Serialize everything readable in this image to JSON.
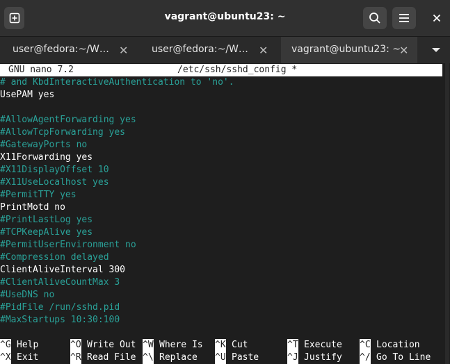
{
  "window": {
    "title": "vagrant@ubuntu23: ~",
    "new_tab_icon": "new-tab-icon",
    "search_icon": "search-icon",
    "menu_icon": "hamburger-menu-icon",
    "close_glyph": "✕"
  },
  "tabs": [
    {
      "label": "user@fedora:~/W…",
      "close": "✕",
      "active": false
    },
    {
      "label": "user@fedora:~/W…",
      "close": "✕",
      "active": false
    },
    {
      "label": "vagrant@ubuntu23: ~",
      "close": "✕",
      "active": true
    }
  ],
  "nano": {
    "version": "GNU nano 7.2",
    "filename": "/etc/ssh/sshd_config *",
    "lines": [
      {
        "text": "# and KbdInteractiveAuthentication to 'no'.",
        "comment": true
      },
      {
        "text": "UsePAM yes",
        "comment": false
      },
      {
        "text": "",
        "comment": false
      },
      {
        "text": "#AllowAgentForwarding yes",
        "comment": true
      },
      {
        "text": "#AllowTcpForwarding yes",
        "comment": true
      },
      {
        "text": "#GatewayPorts no",
        "comment": true
      },
      {
        "text": "X11Forwarding yes",
        "comment": false
      },
      {
        "text": "#X11DisplayOffset 10",
        "comment": true
      },
      {
        "text": "#X11UseLocalhost yes",
        "comment": true
      },
      {
        "text": "#PermitTTY yes",
        "comment": true
      },
      {
        "text": "PrintMotd no",
        "comment": false
      },
      {
        "text": "#PrintLastLog yes",
        "comment": true
      },
      {
        "text": "#TCPKeepAlive yes",
        "comment": true
      },
      {
        "text": "#PermitUserEnvironment no",
        "comment": true
      },
      {
        "text": "#Compression delayed",
        "comment": true
      },
      {
        "text": "ClientAliveInterval 300",
        "comment": false
      },
      {
        "text": "#ClientAliveCountMax 3",
        "comment": true
      },
      {
        "text": "#UseDNS no",
        "comment": true
      },
      {
        "text": "#PidFile /run/sshd.pid",
        "comment": true
      },
      {
        "text": "#MaxStartups 10:30:100",
        "comment": true
      }
    ],
    "shortcuts_row1": [
      {
        "key": "^G",
        "label": "Help"
      },
      {
        "key": "^O",
        "label": "Write Out"
      },
      {
        "key": "^W",
        "label": "Where Is"
      },
      {
        "key": "^K",
        "label": "Cut"
      },
      {
        "key": "^T",
        "label": "Execute"
      },
      {
        "key": "^C",
        "label": "Location"
      }
    ],
    "shortcuts_row2": [
      {
        "key": "^X",
        "label": "Exit"
      },
      {
        "key": "^R",
        "label": "Read File"
      },
      {
        "key": "^\\",
        "label": "Replace"
      },
      {
        "key": "^U",
        "label": "Paste"
      },
      {
        "key": "^J",
        "label": "Justify"
      },
      {
        "key": "^/",
        "label": "Go To Line"
      }
    ]
  },
  "colors": {
    "comment": "#2aa198",
    "text": "#ffffff",
    "terminal_bg": "#1e1e1e",
    "headerbar_bg": "#303030"
  }
}
